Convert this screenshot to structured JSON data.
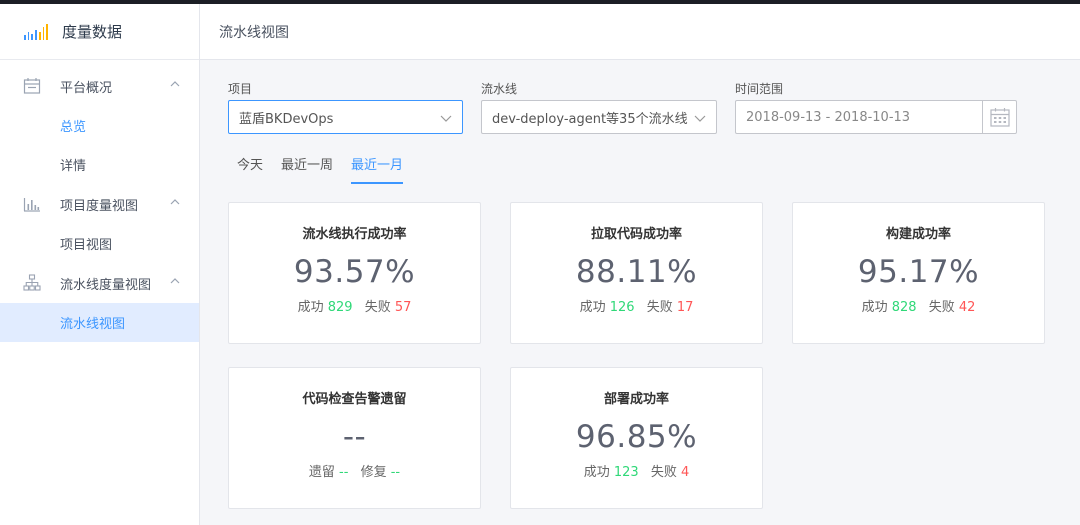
{
  "brand": {
    "title": "度量数据"
  },
  "sidebar": {
    "groups": [
      {
        "label": "平台概况",
        "items": [
          "总览",
          "详情"
        ]
      },
      {
        "label": "项目度量视图",
        "items": [
          "项目视图"
        ]
      },
      {
        "label": "流水线度量视图",
        "items": [
          "流水线视图"
        ]
      }
    ]
  },
  "header": {
    "title": "流水线视图"
  },
  "filters": {
    "project": {
      "label": "项目",
      "value": "蓝盾BKDevOps"
    },
    "pipeline": {
      "label": "流水线",
      "value": "dev-deploy-agent等35个流水线"
    },
    "time": {
      "label": "时间范围",
      "value": "2018-09-13 - 2018-10-13"
    }
  },
  "tabs": [
    "今天",
    "最近一周",
    "最近一月"
  ],
  "active_tab": "最近一月",
  "cards": [
    {
      "title": "流水线执行成功率",
      "value": "93.57%",
      "ok_label": "成功",
      "ok": "829",
      "bad_label": "失败",
      "bad": "57"
    },
    {
      "title": "拉取代码成功率",
      "value": "88.11%",
      "ok_label": "成功",
      "ok": "126",
      "bad_label": "失败",
      "bad": "17"
    },
    {
      "title": "构建成功率",
      "value": "95.17%",
      "ok_label": "成功",
      "ok": "828",
      "bad_label": "失败",
      "bad": "42"
    },
    {
      "title": "代码检查告警遗留",
      "value": "--",
      "ok_label": "遗留",
      "ok": "--",
      "bad_label": "修复",
      "bad": "--"
    },
    {
      "title": "部署成功率",
      "value": "96.85%",
      "ok_label": "成功",
      "ok": "123",
      "bad_label": "失败",
      "bad": "4"
    }
  ],
  "colors": {
    "accent": "#3c96ff",
    "success": "#30d878",
    "fail": "#ff5656",
    "selected_bg": "#e1ecff"
  },
  "icons": [
    "bar-chart-logo-icon",
    "calendar-icon",
    "bar-chart-icon",
    "hierarchy-icon",
    "chevron-up-icon",
    "chevron-down-icon"
  ]
}
